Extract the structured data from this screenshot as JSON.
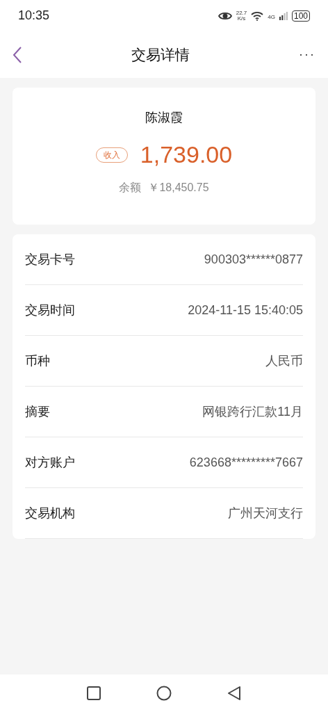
{
  "status_bar": {
    "time": "10:35",
    "speed_value": "22.7",
    "speed_unit": "K/s",
    "network": "4G",
    "battery": "100"
  },
  "header": {
    "title": "交易详情",
    "more": "···"
  },
  "summary": {
    "name": "陈淑霞",
    "tag": "收入",
    "amount": "1,739.00",
    "balance_label": "余额",
    "balance": "￥18,450.75"
  },
  "details": [
    {
      "label": "交易卡号",
      "value": "900303******0877"
    },
    {
      "label": "交易时间",
      "value": "2024-11-15 15:40:05"
    },
    {
      "label": "币种",
      "value": "人民币"
    },
    {
      "label": "摘要",
      "value": "网银跨行汇款11月"
    },
    {
      "label": "对方账户",
      "value": "623668*********7667"
    },
    {
      "label": "交易机构",
      "value": "广州天河支行"
    }
  ]
}
